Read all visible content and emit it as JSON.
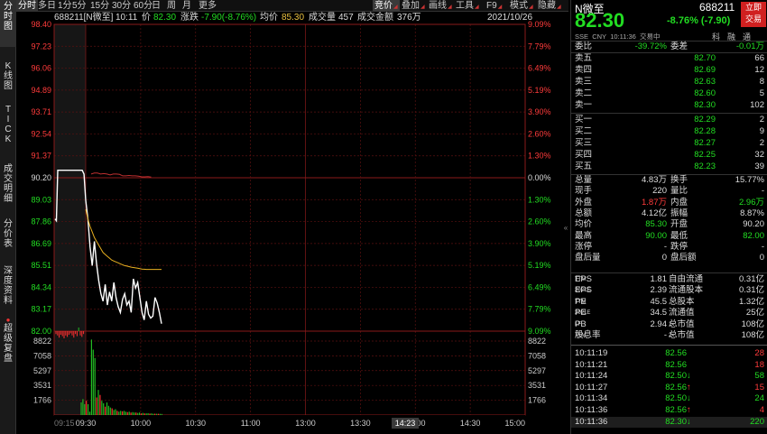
{
  "left_tabs": [
    {
      "label": "分时图",
      "top": 0,
      "height": 52
    },
    {
      "label": "K线图",
      "top": 66,
      "height": 44
    },
    {
      "label": "TICK",
      "top": 114,
      "height": 56
    },
    {
      "label": "成交明细",
      "top": 180,
      "height": 55
    },
    {
      "label": "分价表",
      "top": 241,
      "height": 40
    },
    {
      "label": "深度资料",
      "top": 293,
      "height": 52
    },
    {
      "label": "超级复盘",
      "top": 349,
      "height": 56
    }
  ],
  "toolbar": {
    "left": [
      "分时",
      "多日",
      "1分",
      "5分",
      "15分",
      "30分",
      "60分",
      "日",
      "周",
      "月",
      "更多"
    ],
    "right": [
      "竞价",
      "叠加",
      "画线",
      "工具",
      "F9",
      "模式",
      "隐藏"
    ]
  },
  "info": {
    "code": "688211[N微至]",
    "time": "10:11",
    "price_label": "价",
    "price": "82.30",
    "change_label": "涨跌",
    "change": "-7.90(-8.76%)",
    "avg_label": "均价",
    "avg": "85.30",
    "vol_label": "成交量",
    "vol": "457",
    "amt_label": "成交金额",
    "amt": "376万",
    "date": "2021/10/26"
  },
  "chart_data": {
    "type": "line",
    "title": "688211 N微至 分时",
    "prev_close": 90.2,
    "y_ticks_price": [
      "98.40",
      "97.23",
      "96.06",
      "94.89",
      "93.71",
      "92.54",
      "91.37",
      "90.20",
      "89.03",
      "87.86",
      "86.69",
      "85.51",
      "84.34",
      "83.17",
      "82.00"
    ],
    "y_ticks_pct": [
      "9.09%",
      "7.79%",
      "6.49%",
      "5.19%",
      "3.90%",
      "2.60%",
      "1.30%",
      "0.00%",
      "1.30%",
      "2.60%",
      "3.90%",
      "5.19%",
      "6.49%",
      "7.79%",
      "9.09%"
    ],
    "vol_ticks": [
      "8822",
      "7058",
      "5297",
      "3531",
      "1766"
    ],
    "x_ticks": [
      "09:15",
      "09:30",
      "10:00",
      "10:30",
      "11:00",
      "13:00",
      "13:30",
      "14:00",
      "14:30",
      "15:00"
    ],
    "cursor_time": "14:23",
    "price_series": [
      88.0,
      87.9,
      90.6,
      90.6,
      90.6,
      90.6,
      90.6,
      90.6,
      90.6,
      90.6,
      90.6,
      90.6,
      90.6,
      90.6,
      90.6,
      90.6,
      90.6,
      90.6,
      90.4,
      89.0,
      88.0,
      86.5,
      85.5,
      86.8,
      85.6,
      84.7,
      84.0,
      83.6,
      84.5,
      83.4,
      84.1,
      83.6,
      84.6,
      83.8,
      83.3,
      83.0,
      83.7,
      84.0,
      83.4,
      83.6,
      83.0,
      84.8,
      84.3,
      84.6,
      83.8,
      83.0,
      82.6,
      83.6,
      82.9,
      82.7,
      82.8,
      83.8,
      83.5,
      83.0,
      82.4
    ],
    "avg_series": [
      null,
      null,
      null,
      null,
      null,
      null,
      null,
      null,
      null,
      null,
      null,
      null,
      null,
      null,
      null,
      null,
      null,
      null,
      null,
      88.5,
      88.0,
      87.6,
      87.3,
      87.0,
      86.8,
      86.6,
      86.4,
      86.2,
      86.1,
      86.0,
      85.9,
      85.8,
      85.75,
      85.7,
      85.65,
      85.6,
      85.55,
      85.5,
      85.48,
      85.45,
      85.42,
      85.4,
      85.38,
      85.36,
      85.34,
      85.32,
      85.31,
      85.3,
      85.3,
      85.3,
      85.3,
      85.3,
      85.3,
      85.3,
      85.3
    ],
    "pre_series": [
      90.4,
      90.45,
      90.45,
      90.4,
      90.42,
      90.4,
      90.35,
      90.4,
      90.4,
      90.38,
      90.3,
      90.3,
      90.32,
      90.3,
      90.3,
      90.28,
      90.25,
      90.25,
      90.26,
      90.24
    ],
    "vol_series": [
      1500,
      1900,
      1300,
      1700,
      1300,
      400,
      9000,
      7800,
      6800,
      2100,
      3000,
      2400,
      1700,
      1400,
      1000,
      1500,
      1100,
      900,
      800,
      600,
      700,
      500,
      400,
      500,
      450,
      500,
      400,
      350,
      400,
      300,
      350,
      300,
      300,
      250,
      300,
      200,
      250,
      200,
      200,
      220,
      180,
      200,
      150,
      160,
      150,
      150,
      140,
      130
    ],
    "vol_colors": [
      "g",
      "g",
      "g",
      "r",
      "g",
      "g",
      "g",
      "g",
      "g",
      "r",
      "g",
      "r",
      "g",
      "g",
      "r",
      "g",
      "g",
      "g",
      "r",
      "g",
      "g",
      "r",
      "g",
      "g",
      "r",
      "g",
      "g",
      "r",
      "g",
      "r",
      "g",
      "g",
      "r",
      "g",
      "g",
      "r",
      "g",
      "r",
      "g",
      "g",
      "r",
      "g",
      "g",
      "r",
      "g",
      "r",
      "g",
      "g"
    ],
    "auction_bars": [
      -0.4,
      -0.6,
      -0.9,
      -0.5,
      -0.7,
      -1.0,
      -0.6,
      -0.8,
      -0.5,
      -0.3,
      -0.6,
      -0.9,
      -0.4,
      -0.7,
      0.5,
      -0.6,
      -0.8,
      -0.4
    ],
    "colors": {
      "price": "#ffffff",
      "avg": "#e8b020",
      "pre": "#c03030",
      "grid": "#5a1010",
      "up": "#ff3030",
      "down": "#22bb22"
    }
  },
  "quote": {
    "name": "N微至",
    "code": "688211",
    "price": "82.30",
    "change": "-8.76% (-7.90)",
    "btn1": "立即",
    "btn2": "交易",
    "market": "SSE",
    "currency": "CNY",
    "time": "10:11:36",
    "status": "交易中",
    "icons": [
      "科",
      "融",
      "通"
    ],
    "weibi_label": "委比",
    "weibi": "-39.72%",
    "weicha_label": "委差",
    "weicha": "-0.01万"
  },
  "asks": [
    {
      "label": "卖五",
      "price": "82.70",
      "vol": "66"
    },
    {
      "label": "卖四",
      "price": "82.69",
      "vol": "12"
    },
    {
      "label": "卖三",
      "price": "82.63",
      "vol": "8"
    },
    {
      "label": "卖二",
      "price": "82.60",
      "vol": "5"
    },
    {
      "label": "卖一",
      "price": "82.30",
      "vol": "102"
    }
  ],
  "bids": [
    {
      "label": "买一",
      "price": "82.29",
      "vol": "2"
    },
    {
      "label": "买二",
      "price": "82.28",
      "vol": "9"
    },
    {
      "label": "买三",
      "price": "82.27",
      "vol": "2"
    },
    {
      "label": "买四",
      "price": "82.25",
      "vol": "32"
    },
    {
      "label": "买五",
      "price": "82.23",
      "vol": "39"
    }
  ],
  "stats": [
    [
      {
        "l": "总量",
        "v": "4.83万",
        "c": "wht"
      },
      {
        "l": "换手",
        "v": "15.77%",
        "c": "wht"
      }
    ],
    [
      {
        "l": "现手",
        "v": "220",
        "c": "wht"
      },
      {
        "l": "量比",
        "v": "-",
        "c": "wht"
      }
    ],
    [
      {
        "l": "外盘",
        "v": "1.87万",
        "c": "red"
      },
      {
        "l": "内盘",
        "v": "2.96万",
        "c": "green"
      }
    ],
    [
      {
        "l": "总额",
        "v": "4.12亿",
        "c": "wht"
      },
      {
        "l": "振幅",
        "v": "8.87%",
        "c": "wht"
      }
    ],
    [
      {
        "l": "均价",
        "v": "85.30",
        "c": "green"
      },
      {
        "l": "开盘",
        "v": "90.20",
        "c": "wht"
      }
    ],
    [
      {
        "l": "最高",
        "v": "90.00",
        "c": "green"
      },
      {
        "l": "最低",
        "v": "82.00",
        "c": "green"
      }
    ],
    [
      {
        "l": "涨停",
        "v": "-",
        "c": "wht"
      },
      {
        "l": "跌停",
        "v": "-",
        "c": "wht"
      }
    ],
    [
      {
        "l": "盘后量",
        "v": "0",
        "c": "wht"
      },
      {
        "l": "盘后额",
        "v": "0",
        "c": "wht"
      }
    ]
  ],
  "fundamentals": [
    [
      {
        "l": "EPS",
        "sup": "TTM",
        "v": "1.81"
      },
      {
        "l": "自由流通",
        "sup": "",
        "v": "0.31亿"
      }
    ],
    [
      {
        "l": "EPS",
        "sup": "2021E",
        "v": "2.39"
      },
      {
        "l": "流通股本",
        "sup": "",
        "v": "0.31亿"
      }
    ],
    [
      {
        "l": "PE",
        "sup": "TTM",
        "v": "45.5"
      },
      {
        "l": "总股本",
        "sup": "",
        "v": "1.32亿"
      }
    ],
    [
      {
        "l": "PE",
        "sup": "2021E",
        "v": "34.5"
      },
      {
        "l": "流通值",
        "sup": "",
        "v": "25亿"
      }
    ],
    [
      {
        "l": "PB",
        "sup": "LF",
        "v": "2.94"
      },
      {
        "l": "总市值",
        "sup": "1",
        "v": "108亿"
      }
    ],
    [
      {
        "l": "股息率",
        "sup": "TTM",
        "v": "-"
      },
      {
        "l": "总市值",
        "sup": "2",
        "v": "108亿"
      }
    ]
  ],
  "ticks": [
    {
      "time": "10:11:19",
      "price": "82.56",
      "arrow": "",
      "vol": "28",
      "vc": "red"
    },
    {
      "time": "10:11:21",
      "price": "82.56",
      "arrow": "",
      "vol": "18",
      "vc": "red"
    },
    {
      "time": "10:11:24",
      "price": "82.50",
      "arrow": "↓",
      "vol": "58",
      "vc": "green"
    },
    {
      "time": "10:11:27",
      "price": "82.56",
      "arrow": "↑",
      "vol": "15",
      "vc": "red"
    },
    {
      "time": "10:11:34",
      "price": "82.50",
      "arrow": "↓",
      "vol": "24",
      "vc": "green"
    },
    {
      "time": "10:11:36",
      "price": "82.56",
      "arrow": "↑",
      "vol": "4",
      "vc": "red"
    },
    {
      "time": "10:11:36",
      "price": "82.30",
      "arrow": "↓",
      "vol": "220",
      "vc": "green"
    }
  ]
}
